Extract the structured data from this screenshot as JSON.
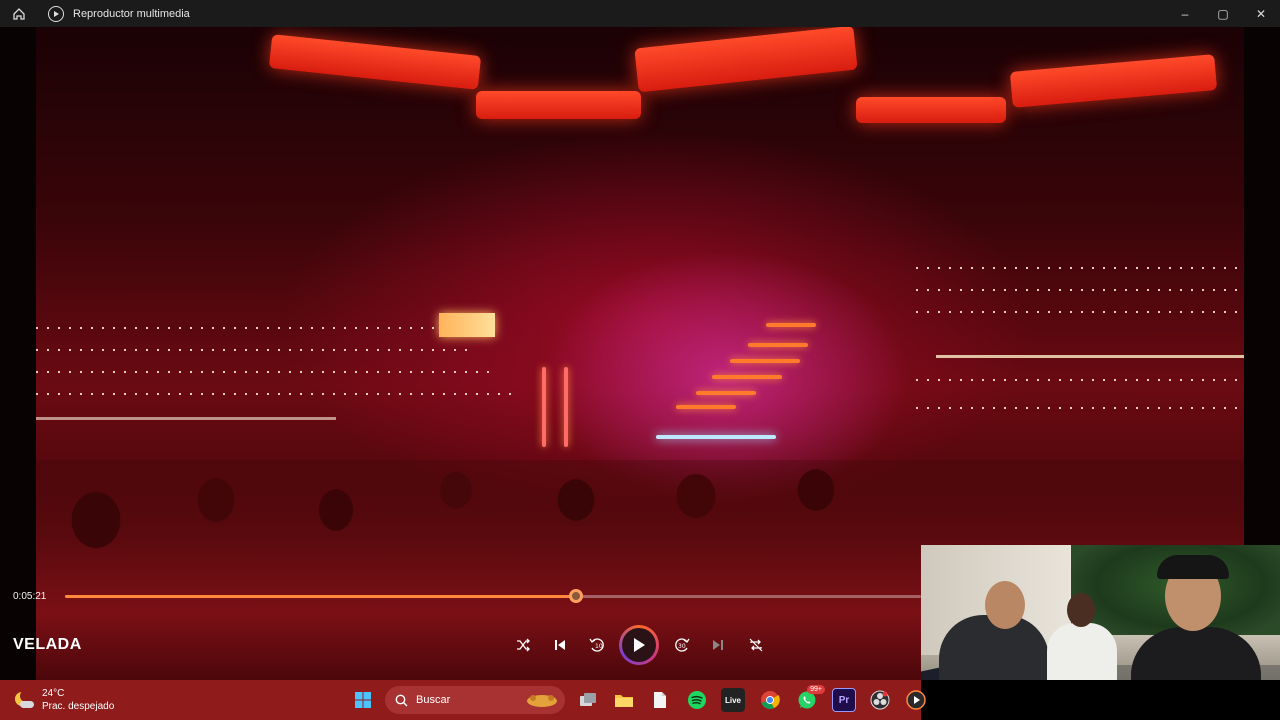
{
  "window": {
    "title": "Reproductor multimedia",
    "minimize": "–",
    "maximize": "▢",
    "close": "✕"
  },
  "player": {
    "current_time": "0:05:21",
    "progress_fraction": 0.597,
    "media_title": "VELADA"
  },
  "taskbar": {
    "weather_temp": "24°C",
    "weather_desc": "Prac. despejado",
    "search_placeholder": "Buscar",
    "whatsapp_badge": "99+",
    "live_label": "Live",
    "premiere_label": "Pr"
  },
  "colors": {
    "accent": "#ff8a3d",
    "taskbar": "#8f1b1b",
    "titlebar": "#1b1b1b"
  }
}
